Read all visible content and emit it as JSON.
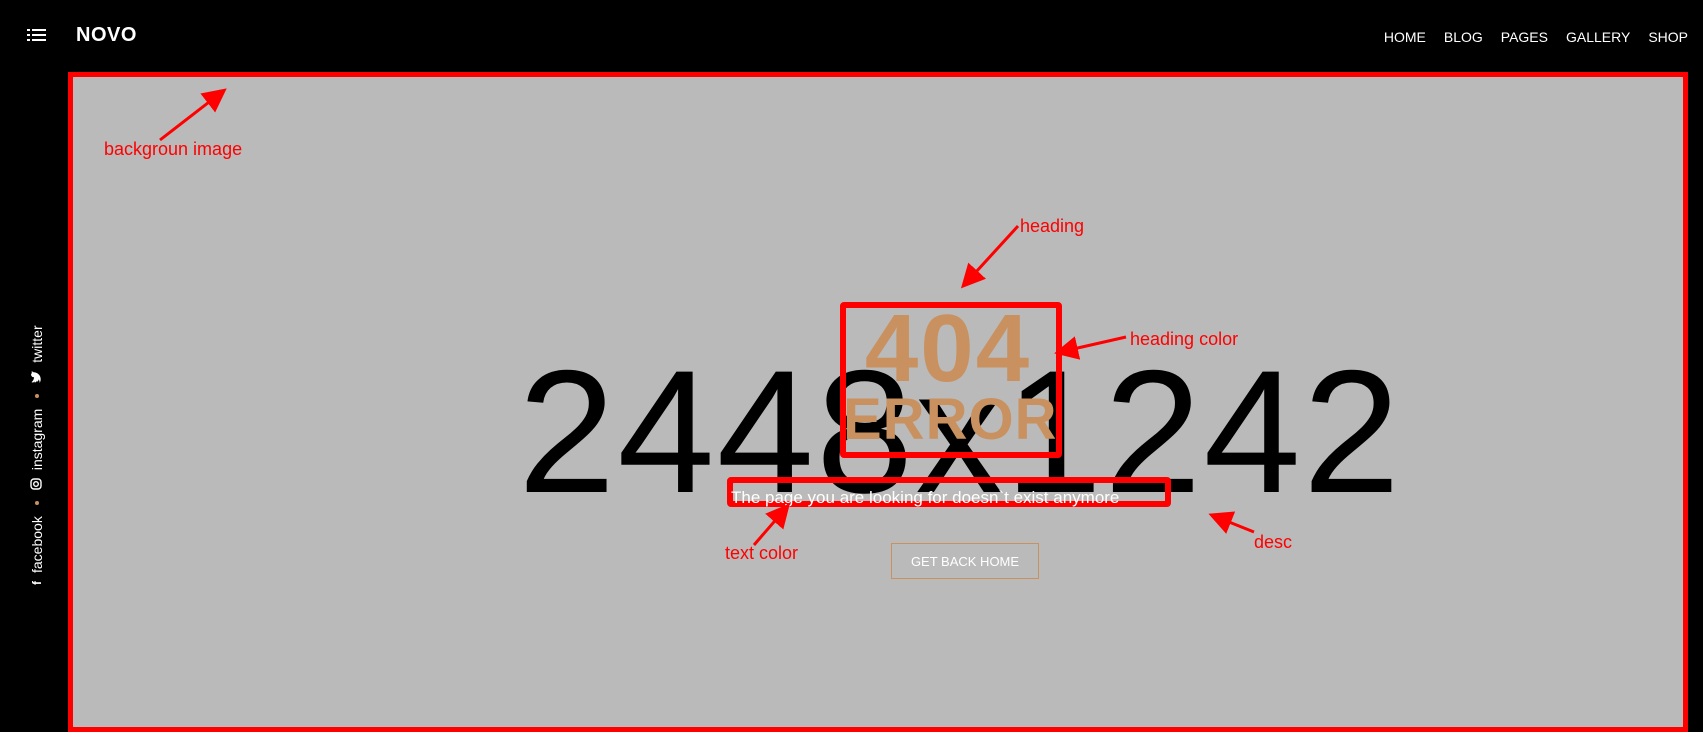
{
  "header": {
    "logo": "NOVO",
    "nav": [
      {
        "label": "HOME",
        "active": false
      },
      {
        "label": "BLOG",
        "active": false
      },
      {
        "label": "PAGES",
        "active": true
      },
      {
        "label": "GALLERY",
        "active": false
      },
      {
        "label": "SHOP",
        "active": false
      }
    ],
    "menu_icon": "hamburger-list-icon"
  },
  "social": {
    "facebook": "facebook",
    "instagram": "instagram",
    "twitter": "twitter",
    "icons": {
      "facebook": "facebook-icon",
      "instagram": "instagram-icon",
      "twitter": "twitter-icon"
    }
  },
  "hero": {
    "placeholder_text": "2448x1242",
    "heading_404": "404",
    "heading_error": "ERROR",
    "description": "The page you are looking for doesn`t exist anymore",
    "button_label": "GET BACK HOME"
  },
  "annotations": {
    "background_image": "backgroun image",
    "heading": "heading",
    "heading_color": "heading color",
    "text_color": "text color",
    "desc": "desc"
  },
  "colors": {
    "topbar_bg": "#000000",
    "hero_bg": "#bababa",
    "heading": "#c8915f",
    "accent": "#a97a4a",
    "annotation": "#ff0000",
    "text": "#ffffff"
  }
}
